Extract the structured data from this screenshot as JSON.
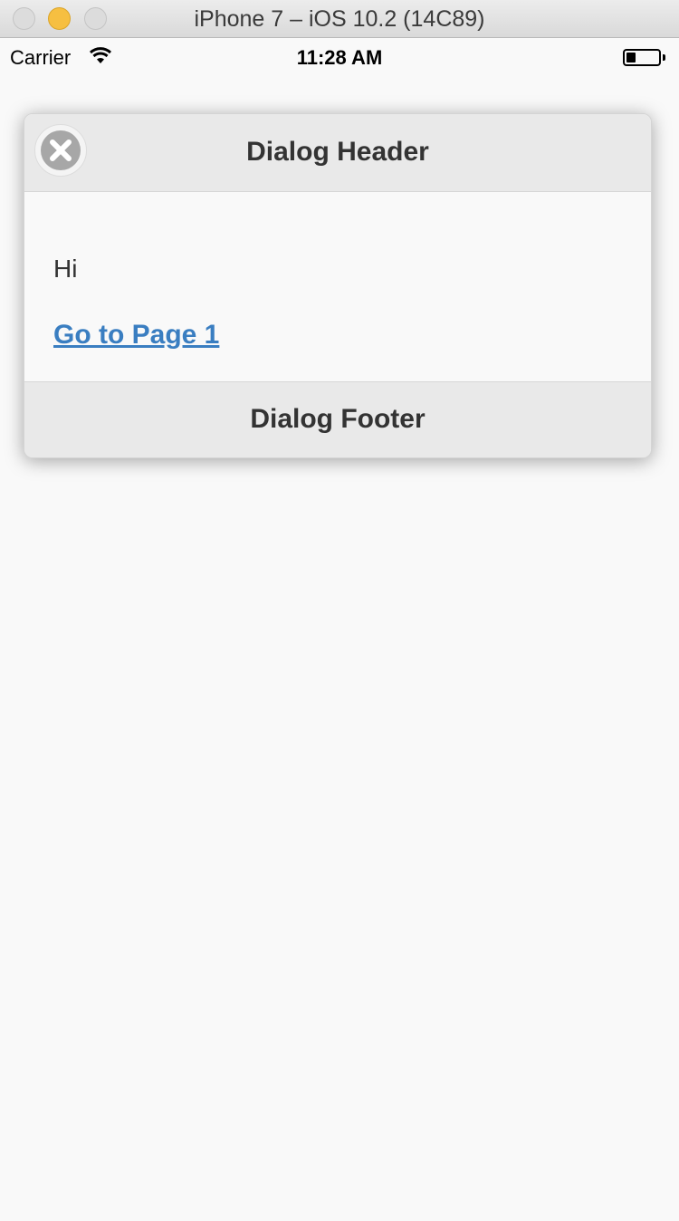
{
  "window": {
    "title": "iPhone 7 – iOS 10.2 (14C89)"
  },
  "status_bar": {
    "carrier": "Carrier",
    "time": "11:28 AM",
    "battery_level": 0.3
  },
  "dialog": {
    "header": "Dialog Header",
    "body_text": "Hi",
    "link_text": "Go to Page 1",
    "footer": "Dialog Footer",
    "close_icon": "close-circle-icon",
    "link_color": "#3a7ec1"
  }
}
